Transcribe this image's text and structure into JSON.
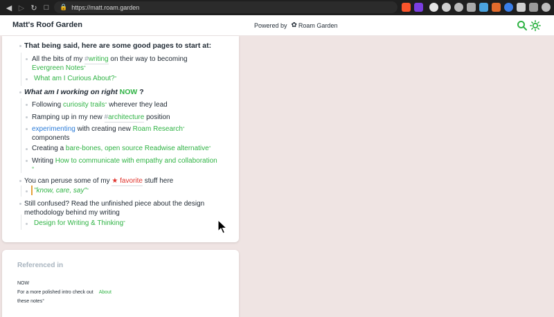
{
  "browser": {
    "url": "https://matt.roam.garden"
  },
  "header": {
    "title": "Matt's Roof Garden",
    "powered_by": "Powered by",
    "brand": "Roam Garden"
  },
  "content": {
    "intro": "That being said, here are some good pages to start at:",
    "writing_pre": "All the bits of my",
    "writing_tag": "writing",
    "writing_post": "on their way to becoming",
    "evergreen": "Evergreen Notes",
    "curious": "What am I Curious About?",
    "working_pre": "What am I working on right",
    "now": "NOW",
    "working_post": "?",
    "following_pre": "Following",
    "curiosity": "curiosity trails",
    "following_post": "wherever they lead",
    "ramping_pre": "Ramping up in my new",
    "architecture_tag": "architecture",
    "ramping_post": "position",
    "experimenting": "experimenting",
    "exp_mid": "with creating new",
    "roam_research": "Roam Research",
    "components": "components",
    "creating_pre": "Creating a",
    "readwise": "bare-bones, open source Readwise alternative",
    "writing2_pre": "Writing",
    "communicate": "How to communicate with empathy and collaboration",
    "peruse_pre": "You can peruse some of my",
    "favorite": "favorite",
    "peruse_post": "stuff here",
    "know_care_say": "\"know, care, say\"",
    "confused_1": "Still confused? Read the unfinished piece about the design",
    "confused_2": "methodology behind my writing",
    "design_writing": "Design for Writing & Thinking",
    "degree": "°",
    "hash": "#",
    "star": "★"
  },
  "references": {
    "title": "Referenced in",
    "item_title": "NOW",
    "item_text": "For a more polished intro check out",
    "item_link_1": "About",
    "item_link_2": "these notes"
  },
  "colors": {
    "link_green": "#2fb344",
    "link_blue": "#2a7bd8",
    "favorite_red": "#e0322b",
    "page_bg": "#efe4e3"
  }
}
